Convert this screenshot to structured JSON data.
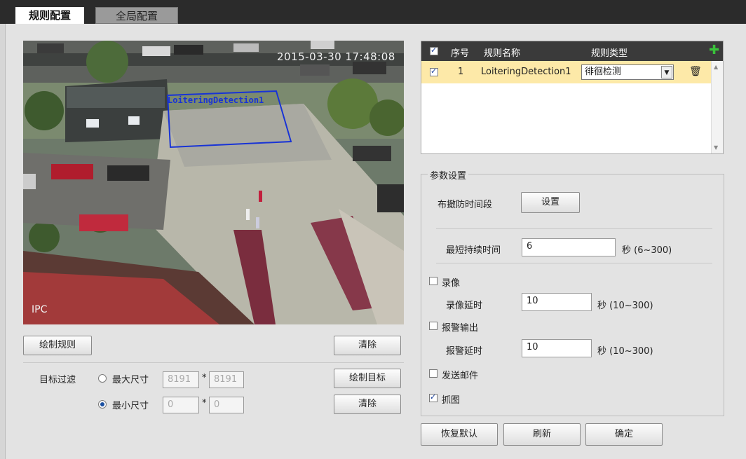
{
  "tabs": {
    "rule_config": "规则配置",
    "global_config": "全局配置"
  },
  "video": {
    "timestamp": "2015-03-30 17:48:08",
    "channel_label": "IPC",
    "rule_overlay_name": "LoiteringDetection1"
  },
  "left_panel": {
    "draw_rule_button": "绘制规则",
    "clear_button_1": "清除",
    "target_filter_label": "目标过滤",
    "max_size_label": "最大尺寸",
    "max_w": "8191",
    "max_h": "8191",
    "min_size_label": "最小尺寸",
    "min_w": "0",
    "min_h": "0",
    "times": "*",
    "draw_target_button": "绘制目标",
    "clear_button_2": "清除",
    "selected_size": "min"
  },
  "rule_table": {
    "headers": {
      "index": "序号",
      "name": "规则名称",
      "type": "规则类型"
    },
    "add_icon": "plus-icon",
    "rows": [
      {
        "checked": true,
        "index": "1",
        "name": "LoiteringDetection1",
        "type": "徘徊检测"
      }
    ]
  },
  "params": {
    "legend": "参数设置",
    "arm_period_label": "布撤防时间段",
    "arm_period_button": "设置",
    "min_duration_label": "最短持续时间",
    "min_duration_value": "6",
    "min_duration_unit": "秒 (6~300)",
    "record_label": "录像",
    "record_checked": false,
    "record_delay_label": "录像延时",
    "record_delay_value": "10",
    "record_delay_unit": "秒 (10~300)",
    "alarm_out_label": "报警输出",
    "alarm_out_checked": false,
    "alarm_delay_label": "报警延时",
    "alarm_delay_value": "10",
    "alarm_delay_unit": "秒 (10~300)",
    "email_label": "发送邮件",
    "email_checked": false,
    "snapshot_label": "抓图",
    "snapshot_checked": true
  },
  "footer": {
    "restore_default": "恢复默认",
    "refresh": "刷新",
    "confirm": "确定"
  },
  "colors": {
    "overlay_blue": "#1833d6",
    "row_highlight": "#fde9a8",
    "header_dark": "#3a3a3a",
    "plus_green": "#2aa52a"
  }
}
